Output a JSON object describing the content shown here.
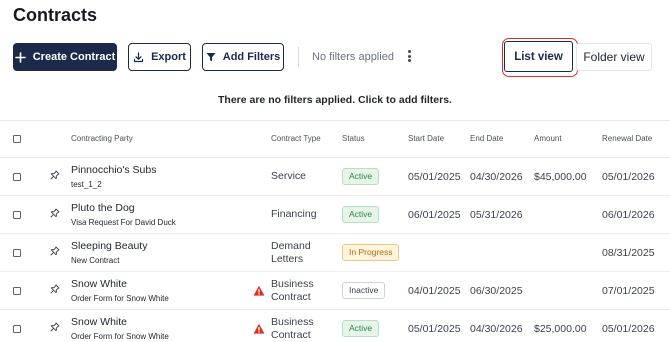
{
  "page": {
    "title": "Contracts"
  },
  "toolbar": {
    "create_label": "Create Contract",
    "export_label": "Export",
    "add_filters_label": "Add Filters",
    "filter_status": "No filters applied",
    "list_view_label": "List view",
    "folder_view_label": "Folder view"
  },
  "filter_message": "There are no filters applied. Click to add filters.",
  "table": {
    "headers": {
      "party": "Contracting Party",
      "type": "Contract Type",
      "status": "Status",
      "start": "Start Date",
      "end": "End Date",
      "amount": "Amount",
      "renewal": "Renewal Date"
    },
    "rows": [
      {
        "party": "Pinnocchio's Subs",
        "subtitle": "test_1_2",
        "warning": false,
        "type": "Service",
        "status": "Active",
        "status_kind": "active",
        "start": "05/01/2025",
        "end": "04/30/2026",
        "amount": "$45,000.00",
        "renewal": "05/01/2026"
      },
      {
        "party": "Pluto the Dog",
        "subtitle": "Visa Request For David Duck",
        "warning": false,
        "type": "Financing",
        "status": "Active",
        "status_kind": "active",
        "start": "06/01/2025",
        "end": "05/31/2026",
        "amount": "",
        "renewal": "06/01/2026"
      },
      {
        "party": "Sleeping Beauty",
        "subtitle": "New Contract",
        "warning": false,
        "type": "Demand Letters",
        "status": "In Progress",
        "status_kind": "progress",
        "start": "",
        "end": "",
        "amount": "",
        "renewal": "08/31/2025"
      },
      {
        "party": "Snow White",
        "subtitle": "Order Form for Snow White",
        "warning": true,
        "type": "Business Contract",
        "status": "Inactive",
        "status_kind": "inactive",
        "start": "04/01/2025",
        "end": "06/30/2025",
        "amount": "",
        "renewal": "07/01/2025"
      },
      {
        "party": "Snow White",
        "subtitle": "Order Form for Snow White",
        "warning": true,
        "type": "Business Contract",
        "status": "Active",
        "status_kind": "active",
        "start": "05/01/2025",
        "end": "04/30/2026",
        "amount": "$25,000.00",
        "renewal": "05/01/2026"
      }
    ]
  },
  "icons": {
    "create": "plus-icon",
    "export": "download-icon",
    "filters": "funnel-icon",
    "more": "kebab-menu-icon",
    "pin": "pin-icon",
    "warning": "warning-icon"
  },
  "colors": {
    "primary": "#1b2a4a",
    "highlight": "#e12a2a",
    "active": "#2b8a3e",
    "in_progress": "#b96a00",
    "warning": "#d93025"
  }
}
